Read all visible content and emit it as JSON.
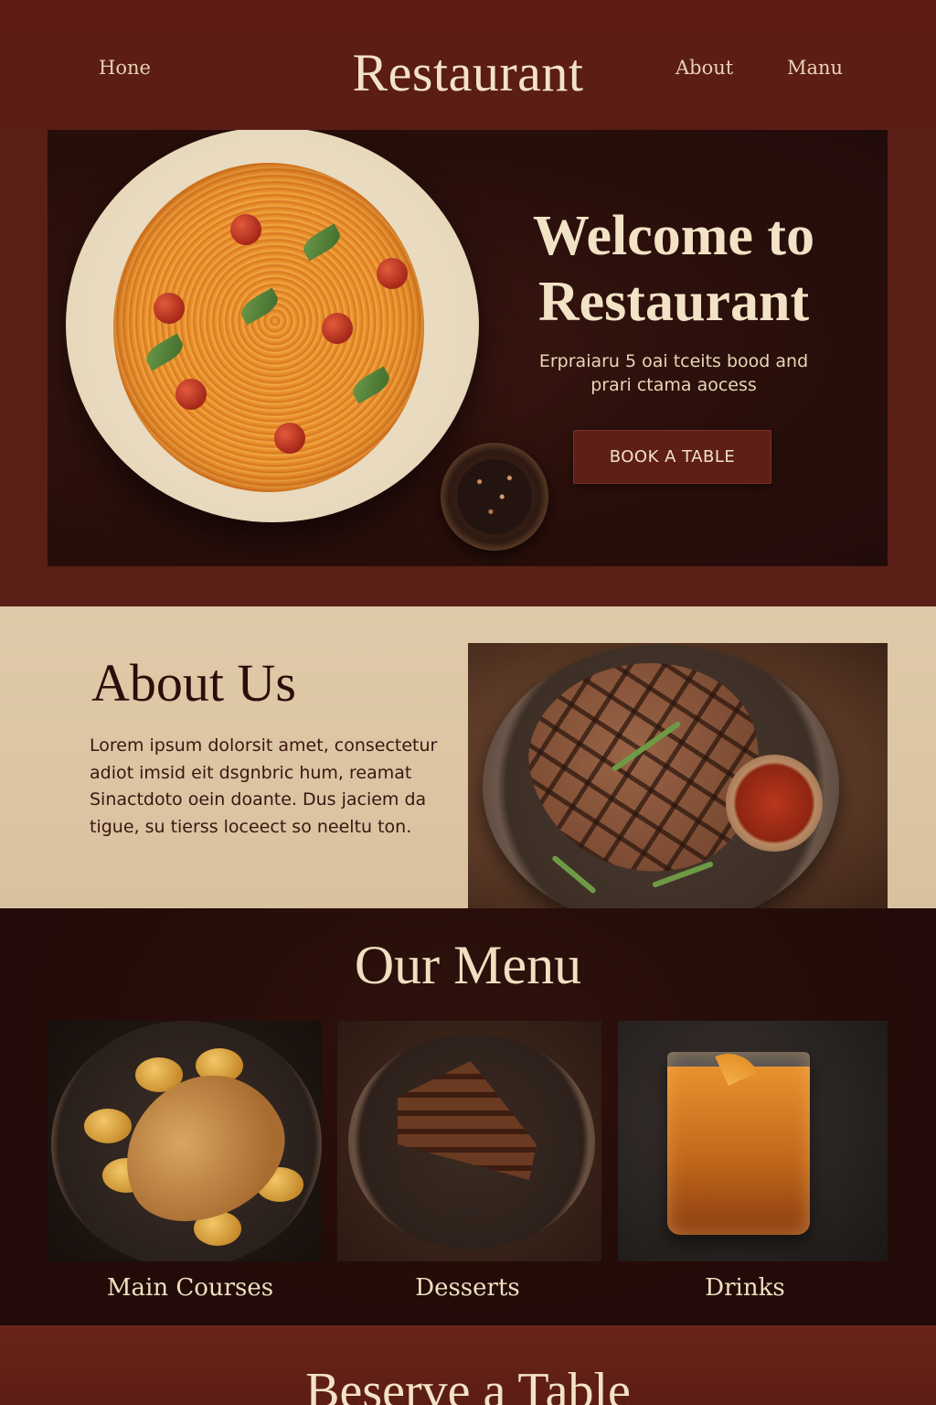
{
  "header": {
    "brand": "Restaurant",
    "nav": {
      "home": "Hone",
      "about": "About",
      "menu": "Manu"
    }
  },
  "hero": {
    "title_line1": "Welcome to",
    "title_line2": "Restaurant",
    "subtitle_line1": "Erpraiaru 5 oai tceits bood and",
    "subtitle_line2": "prari ctama aocess",
    "cta_label": "BOOK A TABLE"
  },
  "about": {
    "title": "About Us",
    "lines": [
      "Lorem ipsum dolorsit amet, consectetur",
      "adiot imsid eit dsgnbric hum, reamat",
      "Sinactdoto oein doante. Dus jaciem da",
      "tigue, su tierss loceect so neeltu ton."
    ],
    "photo": "grilled-steak-photo"
  },
  "menu": {
    "title": "Our Menu",
    "items": [
      {
        "label": "Main Courses",
        "photo": "roast-chicken-photo"
      },
      {
        "label": "Desserts",
        "photo": "chocolate-cake-photo"
      },
      {
        "label": "Drinks",
        "photo": "cocktail-photo"
      }
    ]
  },
  "reserve": {
    "title": "Beserve a Table"
  },
  "hero_photo": "spaghetti-plate-photo",
  "colors": {
    "brand_red": "#5a1f17",
    "hero_dark": "#2a0f0b",
    "cream": "#dfcaa9",
    "menu_dark": "#220b08",
    "text_light": "#f3e3c6",
    "text_dark": "#2d0d0a"
  }
}
